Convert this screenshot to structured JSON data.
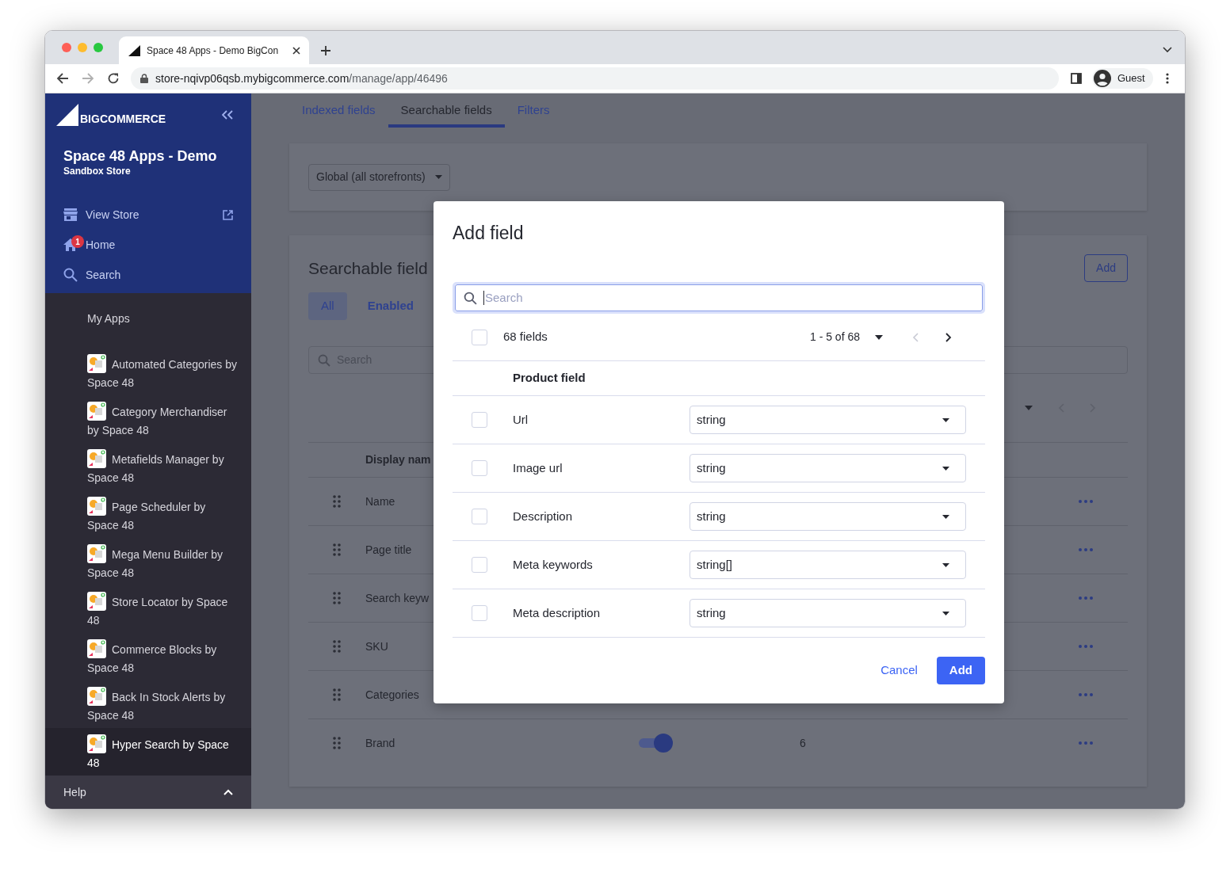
{
  "browser": {
    "tab_title": "Space 48 Apps - Demo BigCon",
    "url_host": "store-nqivp06qsb.mybigcommerce.com",
    "url_path": "/manage/app/46496",
    "profile": "Guest"
  },
  "sidebar": {
    "brand": "BIGCOMMERCE",
    "store_name": "Space 48 Apps - Demo",
    "store_type": "Sandbox Store",
    "nav": [
      {
        "label": "View Store",
        "kind": "store",
        "external": true
      },
      {
        "label": "Home",
        "kind": "home",
        "badge": "1"
      },
      {
        "label": "Search",
        "kind": "search"
      }
    ],
    "section": "My Apps",
    "apps": [
      {
        "label": "Automated Categories by Space 48",
        "selected": false
      },
      {
        "label": "Category Merchandiser by Space 48",
        "selected": false
      },
      {
        "label": "Metafields Manager by Space 48",
        "selected": false
      },
      {
        "label": "Page Scheduler by Space 48",
        "selected": false
      },
      {
        "label": "Mega Menu Builder by Space 48",
        "selected": false
      },
      {
        "label": "Store Locator by Space 48",
        "selected": false
      },
      {
        "label": "Commerce Blocks by Space 48",
        "selected": false
      },
      {
        "label": "Back In Stock Alerts by Space 48",
        "selected": false
      },
      {
        "label": "Hyper Search by Space 48",
        "selected": true
      }
    ],
    "footer": "Help"
  },
  "main": {
    "tabs": [
      {
        "label": "Indexed fields",
        "selected": false
      },
      {
        "label": "Searchable fields",
        "selected": true
      },
      {
        "label": "Filters",
        "selected": false
      }
    ],
    "storefront": "Global (all storefronts)",
    "panel": {
      "title": "Searchable field",
      "add_button": "Add",
      "filters": [
        {
          "label": "All",
          "selected": true
        },
        {
          "label": "Enabled",
          "selected": false
        }
      ],
      "search_placeholder": "Search",
      "column": "Display nam",
      "rows": [
        {
          "name": "Name"
        },
        {
          "name": "Page title"
        },
        {
          "name": "Search keyw"
        },
        {
          "name": "SKU"
        },
        {
          "name": "Categories"
        },
        {
          "name": "Brand",
          "enabled": true,
          "column_3": "6"
        }
      ]
    }
  },
  "dialog": {
    "title": "Add field",
    "search_placeholder": "Search",
    "select_all": false,
    "count": "68 fields",
    "range": "1 - 5 of 68",
    "prev_disabled": true,
    "next_disabled": false,
    "column": "Product field",
    "rows": [
      {
        "field": "Url",
        "type": "string",
        "checked": false
      },
      {
        "field": "Image url",
        "type": "string",
        "checked": false
      },
      {
        "field": "Description",
        "type": "string",
        "checked": false
      },
      {
        "field": "Meta keywords",
        "type": "string[]",
        "checked": false
      },
      {
        "field": "Meta description",
        "type": "string",
        "checked": false
      }
    ],
    "cancel": "Cancel",
    "confirm": "Add"
  }
}
